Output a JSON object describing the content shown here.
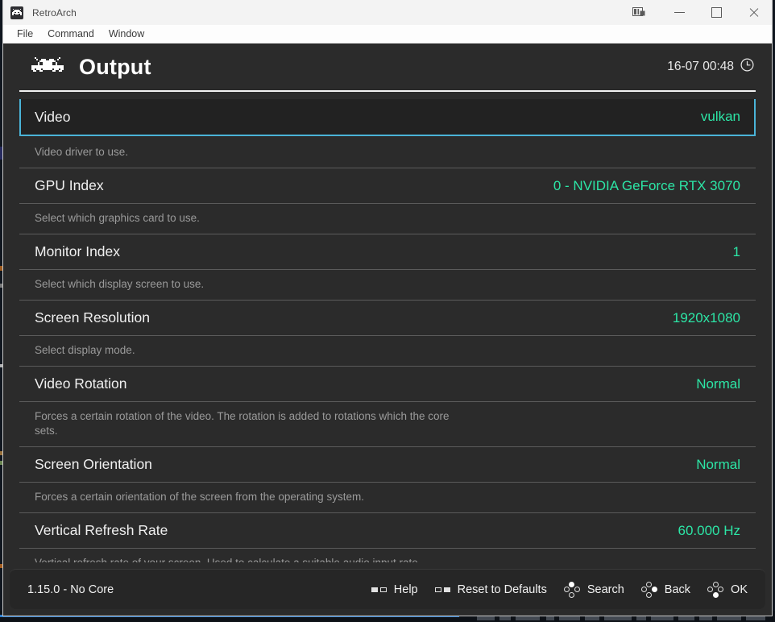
{
  "window": {
    "title": "RetroArch",
    "icon": "retroarch-invader-icon",
    "controls": {
      "snap_label": "layout-snap-icon",
      "minimize_label": "minimize-icon",
      "maximize_label": "maximize-icon",
      "close_label": "close-icon"
    }
  },
  "menubar": {
    "items": [
      {
        "label": "File"
      },
      {
        "label": "Command"
      },
      {
        "label": "Window"
      }
    ]
  },
  "header": {
    "title": "Output",
    "logo_icon": "space-invader-icon",
    "clock_text": "16-07 00:48",
    "clock_icon": "clock-icon"
  },
  "settings": [
    {
      "label": "Video",
      "value": "vulkan",
      "description": "Video driver to use.",
      "selected": true
    },
    {
      "label": "GPU Index",
      "value": "0 - NVIDIA GeForce RTX 3070",
      "description": "Select which graphics card to use.",
      "selected": false
    },
    {
      "label": "Monitor Index",
      "value": "1",
      "description": "Select which display screen to use.",
      "selected": false
    },
    {
      "label": "Screen Resolution",
      "value": "1920x1080",
      "description": "Select display mode.",
      "selected": false
    },
    {
      "label": "Video Rotation",
      "value": "Normal",
      "description": "Forces a certain rotation of the video. The rotation is added to rotations which the core\nsets.",
      "selected": false
    },
    {
      "label": "Screen Orientation",
      "value": "Normal",
      "description": "Forces a certain orientation of the screen from the operating system.",
      "selected": false
    },
    {
      "label": "Vertical Refresh Rate",
      "value": "60.000 Hz",
      "description": "Vertical refresh rate of your screen. Used to calculate a suitable audio input rate.\nThis will be ignored if 'Threaded Video' is enabled.",
      "selected": false
    }
  ],
  "footer": {
    "version": "1.15.0 - No Core",
    "actions": [
      {
        "label": "Help",
        "icon": "shoulder-button-left-icon",
        "icon_type": "shoulder",
        "filled": "left"
      },
      {
        "label": "Reset to Defaults",
        "icon": "shoulder-button-right-icon",
        "icon_type": "shoulder",
        "filled": "right"
      },
      {
        "label": "Search",
        "icon": "gamepad-y-button-icon",
        "icon_type": "pad",
        "filled": "up"
      },
      {
        "label": "Back",
        "icon": "gamepad-b-button-icon",
        "icon_type": "pad",
        "filled": "right"
      },
      {
        "label": "OK",
        "icon": "gamepad-a-button-icon",
        "icon_type": "pad",
        "filled": "down"
      }
    ]
  },
  "colors": {
    "accent_value": "#2ce6a6",
    "selection_border": "#4ab4d8",
    "background": "#2b2b2b",
    "titlebar": "#f3f3f3"
  }
}
